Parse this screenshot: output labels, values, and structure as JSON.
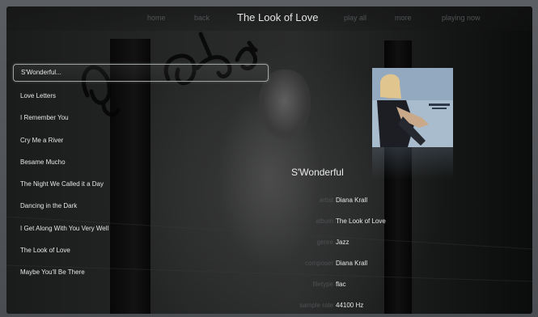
{
  "header": {
    "nav_left": [
      "home",
      "back"
    ],
    "title": "The Look of Love",
    "nav_right": [
      "play all",
      "more",
      "playing now"
    ]
  },
  "playlist": {
    "tracks": [
      "S'Wonderful...",
      "Love Letters",
      "I Remember You",
      "Cry Me a River",
      "Besame Mucho",
      "The Night We Called it a Day",
      "Dancing in the Dark",
      "I Get Along With You Very Well",
      "The Look of Love",
      "Maybe You'll Be There"
    ],
    "selected_index": 0
  },
  "now_playing": {
    "title": "S'Wonderful",
    "details": [
      {
        "label": "artist",
        "value": "Diana Krall"
      },
      {
        "label": "album",
        "value": "The Look of Love"
      },
      {
        "label": "genre",
        "value": "Jazz"
      },
      {
        "label": "composer",
        "value": "Diana Krall"
      },
      {
        "label": "filetype",
        "value": "flac"
      },
      {
        "label": "sample rate",
        "value": "44100 Hz"
      }
    ]
  },
  "colors": {
    "text_primary": "#e6e6e6",
    "text_dim": "#4f5356",
    "selection_border": "#9ea3a6"
  }
}
